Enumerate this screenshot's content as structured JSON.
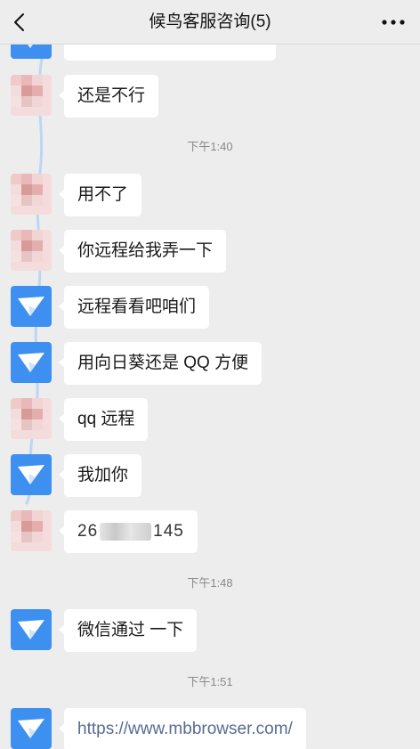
{
  "header": {
    "title": "候鸟客服咨询(5)"
  },
  "messages": {
    "m0": "",
    "m1": "还是不行",
    "t1": "下午1:40",
    "m2": "用不了",
    "m3": "你远程给我弄一下",
    "m4": "远程看看吧咱们",
    "m5": "用向日葵还是 QQ 方便",
    "m6": "qq 远程",
    "m7": "我加你",
    "m8_prefix": "26",
    "m8_suffix": "145",
    "t2": "下午1:48",
    "m9": "微信通过 一下",
    "t3": "下午1:51",
    "m10": "https://www.mbbrowser.com/"
  },
  "colors": {
    "background": "#ededed",
    "bubble": "#ffffff",
    "bot_avatar": "#3d8ff0",
    "link": "#576b95"
  },
  "icons": {
    "back": "chevron-left-icon",
    "more": "more-dots-icon",
    "bot_avatar": "bird-logo-icon"
  }
}
